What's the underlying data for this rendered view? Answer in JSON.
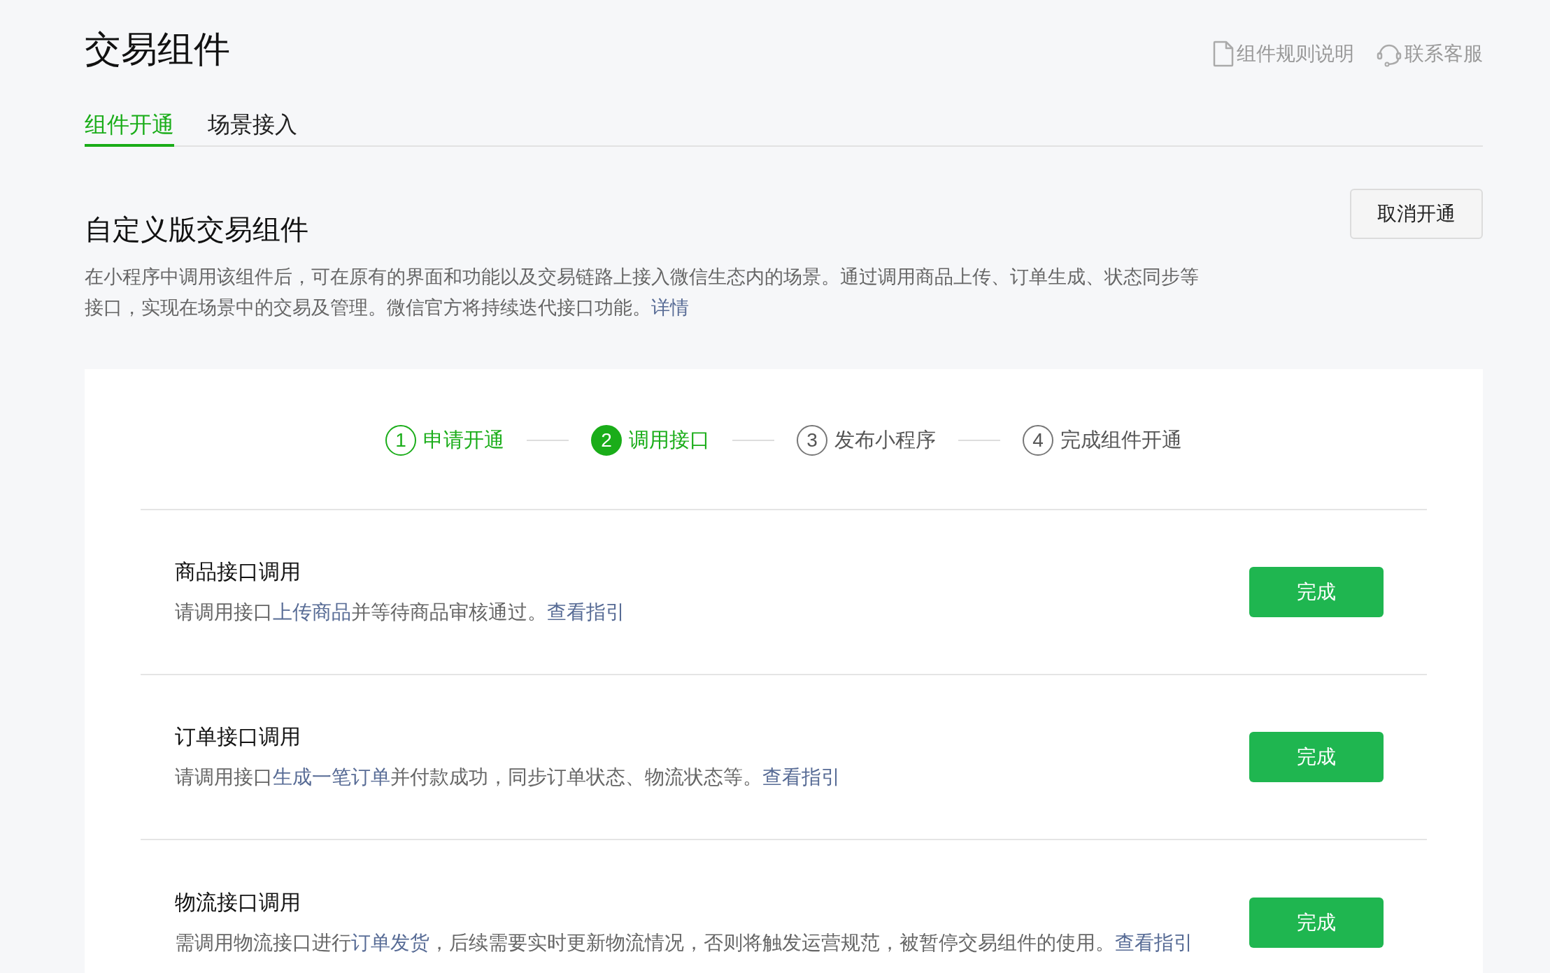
{
  "page": {
    "title": "交易组件"
  },
  "header_links": [
    {
      "kind": "doc",
      "label": "组件规则说明"
    },
    {
      "kind": "support",
      "label": "联系客服"
    }
  ],
  "tabs": [
    {
      "label": "组件开通",
      "selected": true
    },
    {
      "label": "场景接入",
      "selected": false
    }
  ],
  "section": {
    "title": "自定义版交易组件",
    "cancel_button": "取消开通",
    "description": [
      {
        "text": "在小程序中调用该组件后，可在原有的界面和功能以及交易链路上接入微信生态内的场景。通过调用商品上传、订单生成、状态同步等接口，实现在场景中的交易及管理。微信官方将持续迭代接口功能。",
        "link": false
      },
      {
        "text": "详情",
        "link": true
      }
    ]
  },
  "steps": [
    {
      "number": "1",
      "label": "申请开通",
      "selected": false
    },
    {
      "number": "2",
      "label": "调用接口",
      "selected": true
    },
    {
      "number": "3",
      "label": "发布小程序",
      "selected": false
    },
    {
      "number": "4",
      "label": "完成组件开通",
      "selected": false
    }
  ],
  "tasks": [
    {
      "title": "商品接口调用",
      "button": "完成",
      "description": [
        {
          "text": "请调用接口",
          "link": false
        },
        {
          "text": "上传商品",
          "link": true
        },
        {
          "text": "并等待商品审核通过。",
          "link": false
        },
        {
          "text": "查看指引",
          "link": true
        }
      ]
    },
    {
      "title": "订单接口调用",
      "button": "完成",
      "description": [
        {
          "text": "请调用接口",
          "link": false
        },
        {
          "text": "生成一笔订单",
          "link": true
        },
        {
          "text": "并付款成功，同步订单状态、物流状态等。",
          "link": false
        },
        {
          "text": "查看指引",
          "link": true
        }
      ]
    },
    {
      "title": "物流接口调用",
      "button": "完成",
      "description": [
        {
          "text": "需调用物流接口进行",
          "link": false
        },
        {
          "text": "订单发货",
          "link": true
        },
        {
          "text": "，后续需要实时更新物流情况，否则将触发运营规范，被暂停交易组件的使用。",
          "link": false
        },
        {
          "text": "查看指引",
          "link": true
        }
      ]
    }
  ]
}
